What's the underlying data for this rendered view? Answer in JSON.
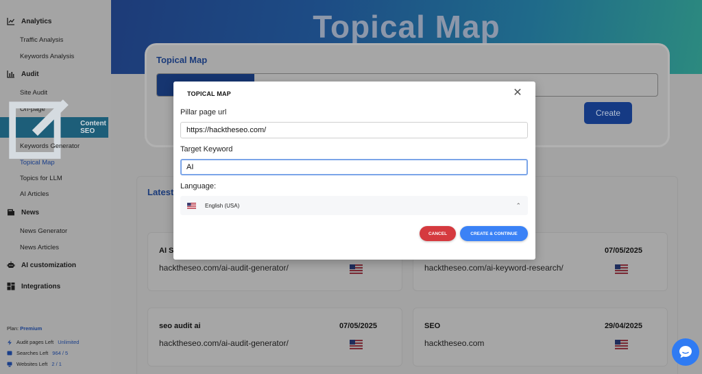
{
  "sidebar": {
    "sections": {
      "analytics": "Analytics",
      "audit": "Audit",
      "content_seo": "Content SEO",
      "news": "News",
      "ai_customization": "AI customization",
      "integrations": "Integrations"
    },
    "items": {
      "traffic_analysis": "Traffic Analysis",
      "keywords_analysis": "Keywords Analysis",
      "site_audit": "Site Audit",
      "on_page": "On-page",
      "keywords_generator": "Keywords Generator",
      "topical_map": "Topical Map",
      "topics_for_llm": "Topics for LLM",
      "ai_articles": "AI Articles",
      "news_generator": "News Generator",
      "news_articles": "News Articles"
    },
    "plan": {
      "label": "Plan:",
      "value": "Premium"
    },
    "stats": [
      {
        "label": "Audit pages Left",
        "value": "Unlimited"
      },
      {
        "label": "Searches Left",
        "value": "964 / 5"
      },
      {
        "label": "Websites Left",
        "value": "2 / 1"
      }
    ]
  },
  "hero": {
    "title": "Topical Map"
  },
  "card": {
    "title": "Topical Map",
    "create_label": "Create"
  },
  "latest": {
    "label": "Latest"
  },
  "articles": [
    {
      "title": "AI S",
      "date": "",
      "url": "hacktheseo.com/ai-audit-generator/"
    },
    {
      "title": "",
      "date": "07/05/2025",
      "url": "hacktheseo.com/ai-keyword-research/"
    },
    {
      "title": "seo audit ai",
      "date": "07/05/2025",
      "url": "hacktheseo.com/ai-audit-generator/"
    },
    {
      "title": "SEO",
      "date": "29/04/2025",
      "url": "hacktheseo.com"
    }
  ],
  "modal": {
    "title": "TOPICAL MAP",
    "pillar_label": "Pillar page url",
    "pillar_value": "https://hacktheseo.com/",
    "keyword_label": "Target Keyword",
    "keyword_value": "AI",
    "language_label": "Language:",
    "language_value": "English (USA)",
    "cancel_label": "CANCEL",
    "continue_label": "CREATE & CONTINUE"
  },
  "colors": {
    "accent": "#3b82f6",
    "cancel": "#d53a3f",
    "brand_dark": "#1b3b7a"
  }
}
